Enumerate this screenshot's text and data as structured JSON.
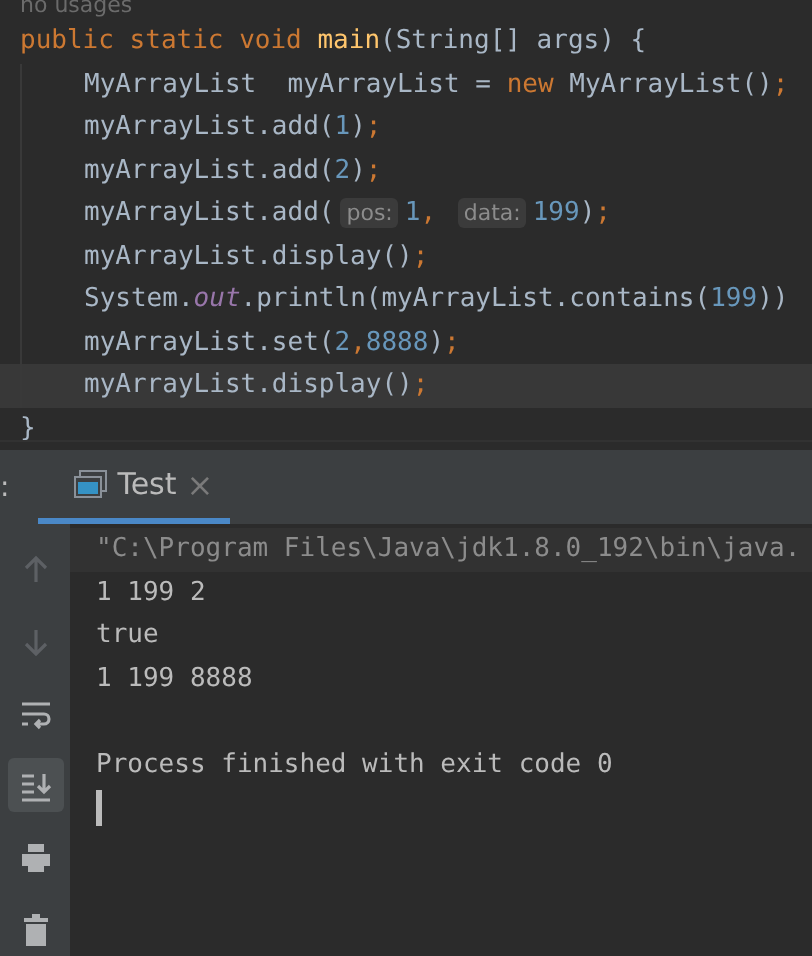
{
  "editor": {
    "hint_above": "no usages",
    "lines": [
      {
        "current": false,
        "tokens": [
          {
            "kind": "kw",
            "text": "public static void "
          },
          {
            "kind": "fn",
            "text": "main"
          },
          {
            "kind": "plain",
            "text": "(String[] args) {"
          }
        ],
        "children": [
          {
            "current": false,
            "tokens": [
              {
                "kind": "plain",
                "text": "MyArrayList  myArrayList = "
              },
              {
                "kind": "kw",
                "text": "new "
              },
              {
                "kind": "plain",
                "text": "MyArrayList()"
              },
              {
                "kind": "kw",
                "text": ";"
              }
            ]
          },
          {
            "current": false,
            "tokens": [
              {
                "kind": "plain",
                "text": "myArrayList.add("
              },
              {
                "kind": "num",
                "text": "1"
              },
              {
                "kind": "plain",
                "text": ")"
              },
              {
                "kind": "kw",
                "text": ";"
              }
            ]
          },
          {
            "current": false,
            "tokens": [
              {
                "kind": "plain",
                "text": "myArrayList.add("
              },
              {
                "kind": "num",
                "text": "2"
              },
              {
                "kind": "plain",
                "text": ")"
              },
              {
                "kind": "kw",
                "text": ";"
              }
            ]
          },
          {
            "current": false,
            "tokens": [
              {
                "kind": "plain",
                "text": "myArrayList.add("
              },
              {
                "kind": "hint",
                "text": "pos:"
              },
              {
                "kind": "num",
                "text": "1"
              },
              {
                "kind": "kw",
                "text": ", "
              },
              {
                "kind": "hint",
                "text": "data:"
              },
              {
                "kind": "num",
                "text": "199"
              },
              {
                "kind": "plain",
                "text": ")"
              },
              {
                "kind": "kw",
                "text": ";"
              }
            ]
          },
          {
            "current": false,
            "tokens": [
              {
                "kind": "plain",
                "text": "myArrayList.display()"
              },
              {
                "kind": "kw",
                "text": ";"
              }
            ]
          },
          {
            "current": false,
            "tokens": [
              {
                "kind": "plain",
                "text": "System."
              },
              {
                "kind": "field",
                "text": "out"
              },
              {
                "kind": "plain",
                "text": ".println(myArrayList.contains("
              },
              {
                "kind": "num",
                "text": "199"
              },
              {
                "kind": "plain",
                "text": "))"
              }
            ]
          },
          {
            "current": false,
            "tokens": [
              {
                "kind": "plain",
                "text": "myArrayList.set("
              },
              {
                "kind": "num",
                "text": "2"
              },
              {
                "kind": "kw",
                "text": ","
              },
              {
                "kind": "num",
                "text": "8888"
              },
              {
                "kind": "plain",
                "text": ")"
              },
              {
                "kind": "kw",
                "text": ";"
              }
            ]
          },
          {
            "current": true,
            "tokens": [
              {
                "kind": "plain",
                "text": "myArrayList.display()"
              },
              {
                "kind": "kw",
                "text": ";"
              }
            ]
          }
        ]
      },
      {
        "current": false,
        "tokens": [
          {
            "kind": "plain",
            "text": "}"
          }
        ]
      }
    ]
  },
  "run_panel": {
    "label_fragment": ":",
    "tabs": [
      {
        "label": "Test",
        "close": "×",
        "selected": true
      }
    ]
  },
  "toolbar": [
    {
      "kind": "up",
      "disabled": true,
      "selected": false
    },
    {
      "kind": "down",
      "disabled": true,
      "selected": false
    },
    {
      "kind": "wrap",
      "disabled": false,
      "selected": false
    },
    {
      "kind": "scroll-end",
      "disabled": false,
      "selected": true
    },
    {
      "kind": "print",
      "disabled": false,
      "selected": false
    },
    {
      "kind": "trash",
      "disabled": false,
      "selected": false
    }
  ],
  "console": [
    {
      "kind": "command",
      "text": "\"C:\\Program Files\\Java\\jdk1.8.0_192\\bin\\java."
    },
    {
      "kind": "output",
      "text": "1 199 2"
    },
    {
      "kind": "output",
      "text": "true"
    },
    {
      "kind": "output",
      "text": "1 199 8888"
    },
    {
      "kind": "blank"
    },
    {
      "kind": "output",
      "text": "Process finished with exit code 0"
    }
  ],
  "caret": true
}
